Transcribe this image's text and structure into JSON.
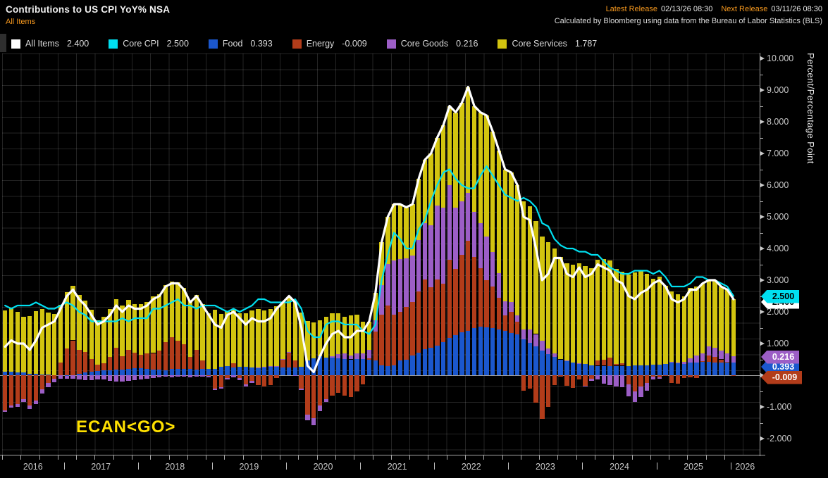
{
  "header": {
    "title": "Contributions to US CPI YoY% NSA",
    "subtitle": "All Items",
    "latest_release_label": "Latest Release",
    "latest_release_value": "02/13/26 08:30",
    "next_release_label": "Next Release",
    "next_release_value": "03/11/26 08:30",
    "source_note": "Calculated by Bloomberg using data from the Bureau of Labor Statistics (BLS)"
  },
  "legend": [
    {
      "label": "All Items",
      "value": "2.400",
      "color": "#ffffff"
    },
    {
      "label": "Core CPI",
      "value": "2.500",
      "color": "#00dff0"
    },
    {
      "label": "Food",
      "value": "0.393",
      "color": "#1b57cd"
    },
    {
      "label": "Energy",
      "value": "-0.009",
      "color": "#b23c1a"
    },
    {
      "label": "Core Goods",
      "value": "0.216",
      "color": "#9c5ec6"
    },
    {
      "label": "Core Services",
      "value": "1.787",
      "color": "#d2c40f"
    }
  ],
  "annotation": "ECAN<GO>",
  "y_axis": {
    "title": "Percent/Percentage Point",
    "major_tick_values": [
      10,
      9,
      8,
      7,
      6,
      5,
      4,
      3,
      2,
      1,
      0,
      -1,
      -2
    ],
    "major_tick_labels": [
      "10.000",
      "9.000",
      "8.000",
      "7.000",
      "6.000",
      "5.000",
      "4.000",
      "3.000",
      "2.000",
      "1.000",
      "",
      "-1.000",
      "-2.000"
    ],
    "minor_step": 0.5
  },
  "x_axis": {
    "years": [
      "2016",
      "2017",
      "2018",
      "2019",
      "2020",
      "2021",
      "2022",
      "2023",
      "2024",
      "2025",
      "2026"
    ]
  },
  "badges": [
    {
      "text": "2.400",
      "color": "#ffffff",
      "text_color": "#000000",
      "value": 2.4
    },
    {
      "text": "2.500",
      "color": "#00dff0",
      "text_color": "#000000",
      "value": 2.5
    },
    {
      "text": "0.393",
      "color": "#1b57cd",
      "text_color": "#ffffff",
      "value": 0.393
    },
    {
      "text": "0.216",
      "color": "#9c5ec6",
      "text_color": "#ffffff",
      "value": 0.216
    },
    {
      "text": "-0.009",
      "color": "#b23c1a",
      "text_color": "#ffffff",
      "value": -0.009
    }
  ],
  "chart_data": {
    "type": "combo: stacked monthly bars + lines",
    "frequency": "monthly",
    "x_start": "2016-03",
    "x_end": "2026-01",
    "n_points": 119,
    "ylim": [
      -2.55,
      10.2
    ],
    "grid": "fine square grid on",
    "legend_position": "top",
    "bar_stack_order_bottom_to_top": [
      "Food",
      "Energy",
      "Core Goods",
      "Core Services"
    ],
    "bar_series": [
      {
        "name": "Food",
        "color": "#1b57cd",
        "values": [
          0.12,
          0.12,
          0.1,
          0.08,
          0.05,
          0.04,
          0.03,
          0.02,
          0.0,
          0.0,
          -0.02,
          0.0,
          0.05,
          0.08,
          0.12,
          0.13,
          0.15,
          0.16,
          0.17,
          0.18,
          0.19,
          0.22,
          0.22,
          0.19,
          0.18,
          0.17,
          0.16,
          0.19,
          0.19,
          0.19,
          0.19,
          0.17,
          0.19,
          0.21,
          0.21,
          0.26,
          0.28,
          0.25,
          0.27,
          0.26,
          0.25,
          0.23,
          0.24,
          0.28,
          0.27,
          0.25,
          0.24,
          0.24,
          0.26,
          0.47,
          0.54,
          0.6,
          0.56,
          0.55,
          0.53,
          0.52,
          0.5,
          0.52,
          0.51,
          0.48,
          0.47,
          0.32,
          0.3,
          0.32,
          0.46,
          0.5,
          0.62,
          0.72,
          0.83,
          0.87,
          0.93,
          1.05,
          1.17,
          1.26,
          1.35,
          1.4,
          1.48,
          1.53,
          1.52,
          1.48,
          1.44,
          1.4,
          1.34,
          1.28,
          1.14,
          1.03,
          0.91,
          0.78,
          0.66,
          0.58,
          0.5,
          0.45,
          0.4,
          0.37,
          0.35,
          0.31,
          0.3,
          0.3,
          0.29,
          0.3,
          0.3,
          0.29,
          0.31,
          0.32,
          0.32,
          0.34,
          0.34,
          0.36,
          0.41,
          0.38,
          0.36,
          0.41,
          0.4,
          0.43,
          0.42,
          0.41,
          0.4,
          0.39,
          0.39
        ]
      },
      {
        "name": "Energy",
        "color": "#b23c1a",
        "values": [
          -1.1,
          -0.95,
          -0.9,
          -0.75,
          -0.95,
          -0.8,
          -0.45,
          -0.25,
          -0.1,
          0.4,
          0.85,
          1.1,
          0.75,
          0.65,
          0.4,
          0.2,
          0.22,
          0.42,
          0.7,
          0.42,
          0.62,
          0.5,
          0.42,
          0.5,
          0.52,
          0.6,
          0.88,
          1.0,
          0.9,
          0.78,
          0.38,
          0.62,
          0.28,
          -0.02,
          -0.42,
          -0.38,
          -0.08,
          0.12,
          -0.08,
          -0.28,
          -0.18,
          -0.3,
          -0.35,
          -0.3,
          -0.08,
          0.25,
          0.48,
          0.22,
          -0.42,
          -1.25,
          -1.35,
          -0.95,
          -0.75,
          -0.65,
          -0.55,
          -0.65,
          -0.68,
          -0.52,
          -0.28,
          0.05,
          0.9,
          1.6,
          1.9,
          1.6,
          1.55,
          1.65,
          1.7,
          1.92,
          2.2,
          1.9,
          2.1,
          1.85,
          2.48,
          2.1,
          2.45,
          2.85,
          2.25,
          1.85,
          1.48,
          1.32,
          1.0,
          0.48,
          0.66,
          0.42,
          -0.49,
          -0.43,
          -0.86,
          -1.38,
          -1.01,
          -0.31,
          -0.04,
          -0.33,
          -0.39,
          -0.13,
          -0.33,
          -0.12,
          0.16,
          0.19,
          0.26,
          0.06,
          0.08,
          -0.29,
          -0.51,
          -0.36,
          -0.24,
          -0.04,
          -0.06,
          -0.02,
          -0.25,
          -0.26,
          -0.09,
          -0.06,
          -0.09,
          0.01,
          0.2,
          0.16,
          0.1,
          0.04,
          -0.01
        ]
      },
      {
        "name": "Core Goods",
        "color": "#9c5ec6",
        "values": [
          -0.05,
          -0.08,
          -0.1,
          -0.1,
          -0.11,
          -0.12,
          -0.13,
          -0.12,
          -0.13,
          -0.12,
          -0.1,
          -0.12,
          -0.13,
          -0.15,
          -0.16,
          -0.13,
          -0.14,
          -0.18,
          -0.2,
          -0.19,
          -0.17,
          -0.15,
          -0.14,
          -0.12,
          -0.08,
          -0.06,
          -0.05,
          -0.06,
          -0.04,
          -0.05,
          -0.06,
          -0.04,
          -0.05,
          -0.04,
          -0.04,
          -0.05,
          -0.05,
          -0.06,
          -0.07,
          -0.08,
          -0.06,
          0.01,
          0.03,
          0.01,
          0.01,
          0.01,
          0.01,
          -0.02,
          -0.05,
          -0.17,
          -0.22,
          -0.19,
          -0.1,
          0.06,
          0.13,
          0.16,
          0.12,
          0.16,
          0.17,
          0.26,
          0.36,
          0.92,
          1.32,
          1.7,
          1.66,
          1.55,
          1.45,
          1.62,
          1.77,
          1.97,
          2.33,
          2.4,
          2.36,
          1.92,
          1.7,
          1.5,
          1.42,
          1.41,
          1.38,
          1.08,
          0.78,
          0.46,
          0.31,
          0.2,
          0.31,
          0.41,
          0.39,
          0.31,
          0.19,
          0.1,
          0.0,
          0.01,
          0.0,
          0.01,
          -0.02,
          -0.06,
          -0.14,
          -0.26,
          -0.32,
          -0.35,
          -0.37,
          -0.38,
          -0.33,
          -0.33,
          -0.26,
          -0.1,
          -0.05,
          0.0,
          0.01,
          0.03,
          0.06,
          0.12,
          0.23,
          0.25,
          0.3,
          0.3,
          0.28,
          0.25,
          0.22
        ]
      },
      {
        "name": "Core Services",
        "color": "#d2c40f",
        "values": [
          1.93,
          2.01,
          1.9,
          1.77,
          1.81,
          1.98,
          2.05,
          1.95,
          1.93,
          1.82,
          1.77,
          1.72,
          1.73,
          1.62,
          1.54,
          1.4,
          1.47,
          1.5,
          1.53,
          1.59,
          1.56,
          1.53,
          1.6,
          1.63,
          1.78,
          1.79,
          1.81,
          1.77,
          1.85,
          1.78,
          1.79,
          1.75,
          1.78,
          1.75,
          1.85,
          1.67,
          1.75,
          1.69,
          1.68,
          1.7,
          1.79,
          1.86,
          1.78,
          1.81,
          1.9,
          1.79,
          1.77,
          1.86,
          1.71,
          1.25,
          1.13,
          1.14,
          1.29,
          1.34,
          1.29,
          1.17,
          1.26,
          1.24,
          1.0,
          0.91,
          0.87,
          1.36,
          1.48,
          1.78,
          1.73,
          1.6,
          1.63,
          1.94,
          2.0,
          2.26,
          2.14,
          2.6,
          2.49,
          3.02,
          3.1,
          3.35,
          3.35,
          3.51,
          3.82,
          3.82,
          3.88,
          4.16,
          4.09,
          4.1,
          4.04,
          3.89,
          3.56,
          3.29,
          3.36,
          3.33,
          3.24,
          3.07,
          3.09,
          3.15,
          3.1,
          3.07,
          3.18,
          3.17,
          3.07,
          2.99,
          2.89,
          2.88,
          2.93,
          2.97,
          2.88,
          2.7,
          2.77,
          2.46,
          2.23,
          2.15,
          2.07,
          2.23,
          2.16,
          2.21,
          2.08,
          2.13,
          2.02,
          2.02,
          1.79
        ]
      }
    ],
    "line_series": [
      {
        "name": "Core CPI",
        "color": "#00dff0",
        "width": 2.2,
        "values": [
          2.2,
          2.1,
          2.2,
          2.2,
          2.2,
          2.3,
          2.2,
          2.1,
          2.1,
          2.2,
          2.3,
          2.2,
          2.0,
          1.9,
          1.7,
          1.7,
          1.7,
          1.7,
          1.7,
          1.8,
          1.7,
          1.8,
          1.8,
          1.8,
          2.1,
          2.1,
          2.2,
          2.3,
          2.4,
          2.2,
          2.2,
          2.1,
          2.2,
          2.2,
          2.2,
          2.1,
          2.0,
          2.1,
          2.0,
          2.1,
          2.2,
          2.4,
          2.4,
          2.3,
          2.3,
          2.3,
          2.3,
          2.4,
          2.1,
          1.4,
          1.2,
          1.2,
          1.6,
          1.7,
          1.7,
          1.6,
          1.6,
          1.6,
          1.4,
          1.3,
          1.6,
          3.0,
          3.8,
          4.5,
          4.3,
          4.0,
          4.0,
          4.6,
          4.9,
          5.5,
          6.0,
          6.4,
          6.5,
          6.2,
          6.0,
          5.9,
          5.9,
          6.3,
          6.6,
          6.3,
          6.0,
          5.7,
          5.6,
          5.5,
          5.6,
          5.5,
          5.3,
          4.8,
          4.7,
          4.3,
          4.1,
          4.0,
          4.0,
          3.9,
          3.9,
          3.8,
          3.8,
          3.6,
          3.4,
          3.3,
          3.2,
          3.2,
          3.3,
          3.3,
          3.3,
          3.2,
          3.3,
          3.1,
          2.8,
          2.8,
          2.8,
          2.9,
          3.1,
          3.1,
          3.0,
          3.0,
          2.9,
          2.8,
          2.5
        ]
      },
      {
        "name": "All Items",
        "color": "#ffffff",
        "width": 3.2,
        "values": [
          0.9,
          1.1,
          1.0,
          1.0,
          0.8,
          1.1,
          1.5,
          1.6,
          1.7,
          2.1,
          2.5,
          2.7,
          2.4,
          2.2,
          1.9,
          1.6,
          1.7,
          1.9,
          2.2,
          2.0,
          2.2,
          2.1,
          2.1,
          2.2,
          2.4,
          2.5,
          2.8,
          2.9,
          2.9,
          2.7,
          2.3,
          2.5,
          2.2,
          1.9,
          1.6,
          1.5,
          1.9,
          2.0,
          1.8,
          1.6,
          1.8,
          1.7,
          1.7,
          1.8,
          2.1,
          2.3,
          2.5,
          2.3,
          1.5,
          0.3,
          0.1,
          0.6,
          1.0,
          1.3,
          1.4,
          1.2,
          1.2,
          1.4,
          1.4,
          1.7,
          2.6,
          4.2,
          5.0,
          5.4,
          5.4,
          5.3,
          5.4,
          6.2,
          6.8,
          7.0,
          7.5,
          7.9,
          8.5,
          8.3,
          8.6,
          9.1,
          8.5,
          8.3,
          8.2,
          7.7,
          7.1,
          6.5,
          6.4,
          6.0,
          5.0,
          4.9,
          4.0,
          3.0,
          3.2,
          3.7,
          3.7,
          3.2,
          3.1,
          3.4,
          3.1,
          3.2,
          3.5,
          3.4,
          3.3,
          3.0,
          2.9,
          2.5,
          2.4,
          2.6,
          2.7,
          2.9,
          3.0,
          2.8,
          2.4,
          2.3,
          2.4,
          2.7,
          2.7,
          2.9,
          3.0,
          3.0,
          2.8,
          2.7,
          2.4
        ]
      }
    ]
  }
}
